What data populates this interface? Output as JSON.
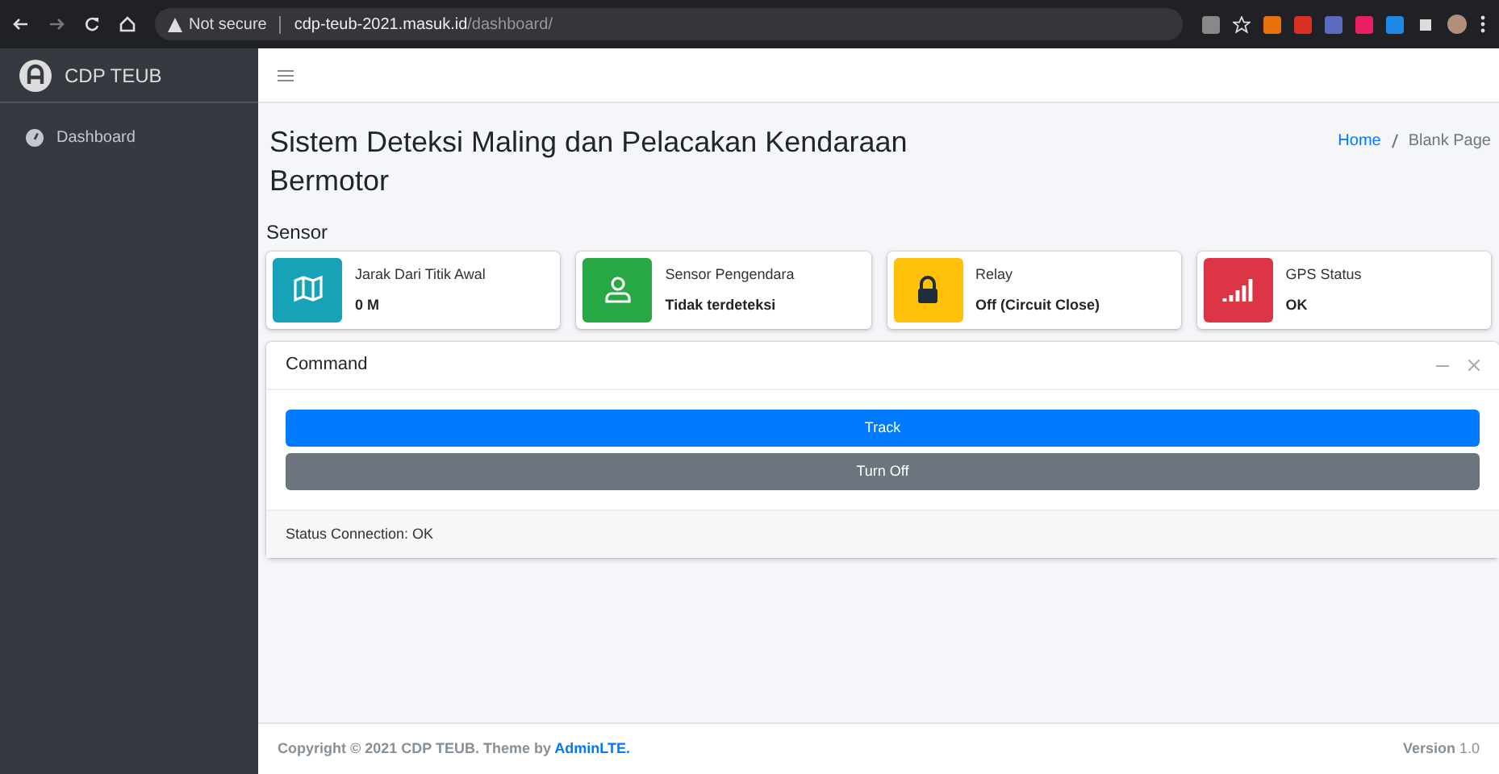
{
  "browser": {
    "security_label": "Not secure",
    "url_host": "cdp-teub-2021.masuk.id",
    "url_path": "/dashboard/"
  },
  "brand": {
    "name": "CDP TEUB"
  },
  "sidebar": {
    "items": [
      {
        "label": "Dashboard",
        "selected": false
      }
    ]
  },
  "page": {
    "title": "Sistem Deteksi Maling dan Pelacakan Kendaraan Bermotor",
    "breadcrumb": [
      {
        "label": "Home",
        "kind": "link"
      },
      {
        "label": "Blank Page",
        "kind": "current"
      }
    ]
  },
  "section_label": "Sensor",
  "info_boxes": [
    {
      "kind": "map",
      "label": "Jarak Dari Titik Awal",
      "value": "0 M",
      "color": "#17a2b8"
    },
    {
      "kind": "user",
      "label": "Sensor Pengendara",
      "value": "Tidak terdeteksi",
      "color": "#28a745"
    },
    {
      "kind": "lock",
      "label": "Relay",
      "value": "Off (Circuit Close)",
      "color": "#ffc107"
    },
    {
      "kind": "signal",
      "label": "GPS Status",
      "value": "OK",
      "color": "#dc3545"
    }
  ],
  "card": {
    "title": "Command",
    "buttons": [
      {
        "label": "Track",
        "kind": "primary"
      },
      {
        "label": "Turn Off",
        "kind": "secondary"
      }
    ],
    "footer": "Status Connection: OK"
  },
  "footer": {
    "copyright": "Copyright © 2021 CDP TEUB. Theme by ",
    "link": "AdminLTE.",
    "version_label": "Version",
    "version": "1.0"
  }
}
